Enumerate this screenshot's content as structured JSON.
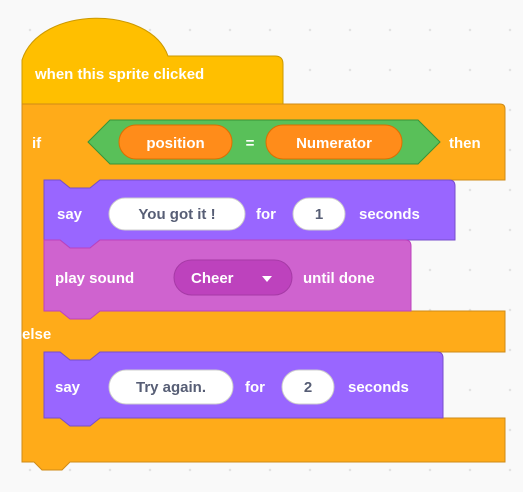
{
  "colors": {
    "events": "#ffbf00",
    "control": "#ffab19",
    "looks": "#9966ff",
    "sound": "#cf63cf",
    "operators": "#59c059",
    "variables": "#ff8c1a"
  },
  "script": {
    "hat_label": "when this sprite clicked",
    "if_label": "if",
    "then_label": "then",
    "else_label": "else",
    "condition": {
      "left_variable": "position",
      "operator": "=",
      "right_variable": "Numerator"
    },
    "if_branch": {
      "say": {
        "label": "say",
        "message": "You got it !",
        "for_label": "for",
        "seconds": "1",
        "seconds_label": "seconds"
      },
      "play_sound": {
        "label": "play sound",
        "sound": "Cheer",
        "dropdown_icon": "caret-down-icon",
        "suffix": "until done"
      }
    },
    "else_branch": {
      "say": {
        "label": "say",
        "message": "Try again.",
        "for_label": "for",
        "seconds": "2",
        "seconds_label": "seconds"
      }
    }
  }
}
